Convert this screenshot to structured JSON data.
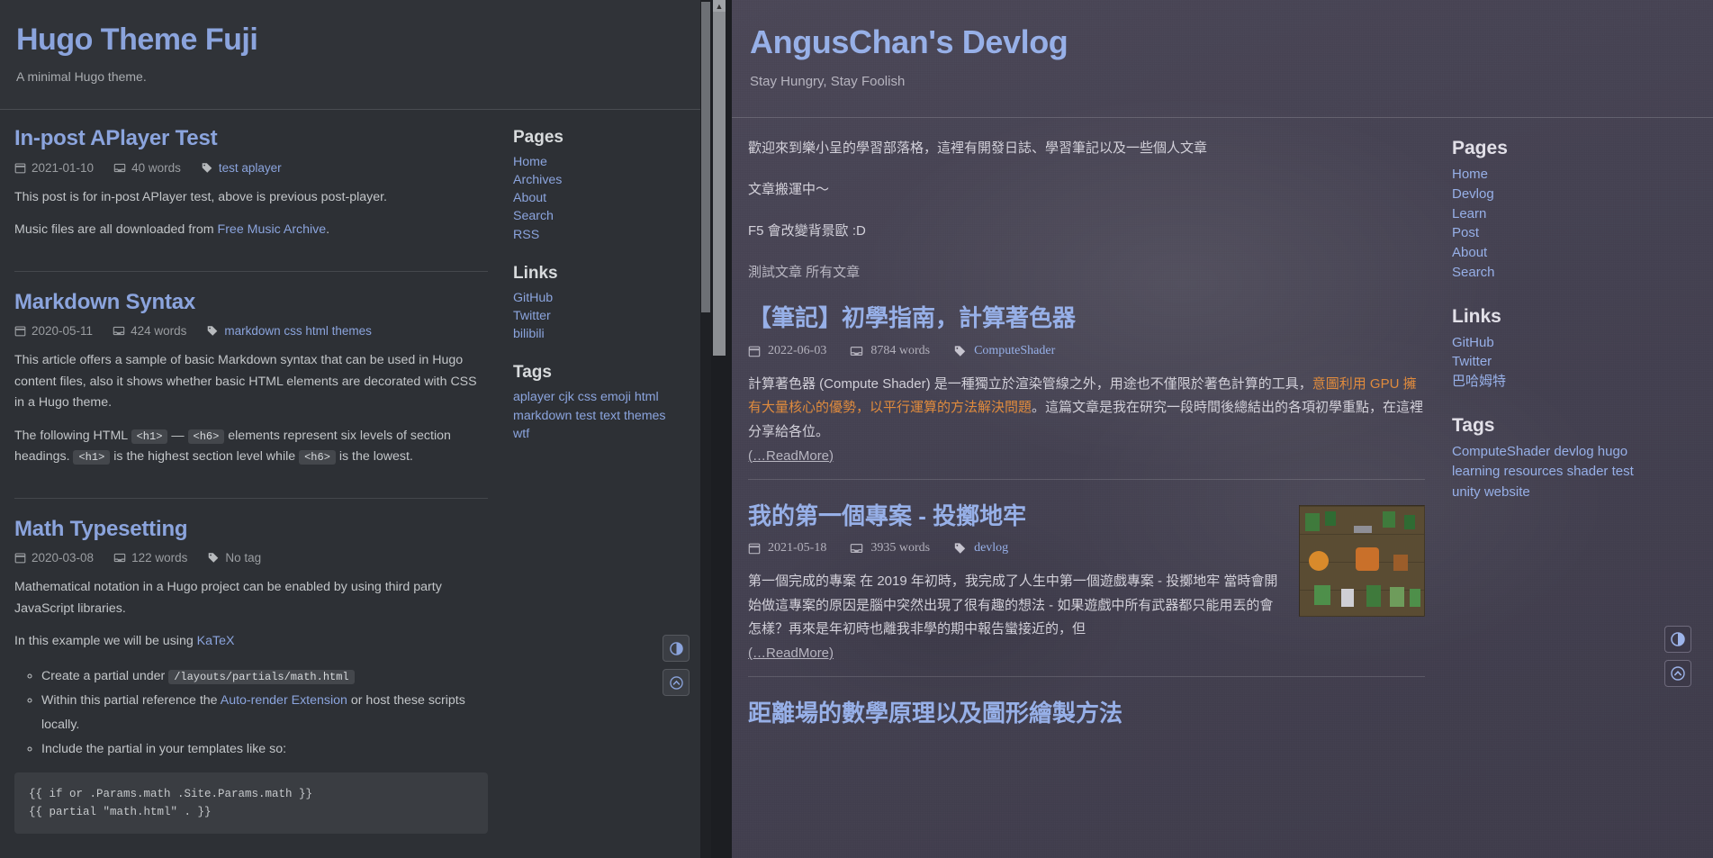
{
  "left_panel": {
    "header": {
      "site_title": "Hugo Theme Fuji",
      "subtitle": "A minimal Hugo theme."
    },
    "posts": [
      {
        "title": "In-post APlayer Test",
        "date": "2021-01-10",
        "words": "40 words",
        "tags": "test aplayer",
        "paragraphs": [
          "This post is for in-post APlayer test, above is previous post-player.",
          "Music files are all downloaded from Free Music Archive."
        ],
        "link_text": "Free Music Archive"
      },
      {
        "title": "Markdown Syntax",
        "date": "2020-05-11",
        "words": "424 words",
        "tags": "markdown css html themes",
        "paragraphs": [
          "This article offers a sample of basic Markdown syntax that can be used in Hugo content files, also it shows whether basic HTML elements are decorated with CSS in a Hugo theme."
        ],
        "html_sentence_1": "The following HTML",
        "code_h1": "<h1>",
        "dash": "—",
        "code_h6": "<h6>",
        "html_sentence_2": "elements represent six levels of section headings.",
        "html_sentence_3": "is the highest section level while",
        "code_h6b": "<h6>",
        "html_sentence_4": "is the lowest."
      },
      {
        "title": "Math Typesetting",
        "date": "2020-03-08",
        "words": "122 words",
        "tags": "No tag",
        "paragraphs": [
          "Mathematical notation in a Hugo project can be enabled by using third party JavaScript libraries.",
          "In this example we will be using KaTeX"
        ],
        "katex_link": "KaTeX",
        "bullets": [
          {
            "pre": "Create a partial under",
            "code": "/layouts/partials/math.html",
            "post": ""
          },
          {
            "pre": "Within this partial reference the",
            "link": "Auto-render Extension",
            "post": "or host these scripts locally."
          },
          {
            "pre": "Include the partial in your templates like so:",
            "code": "",
            "post": ""
          }
        ],
        "codeblock": "{{ if or .Params.math .Site.Params.math }}\n{{ partial \"math.html\" . }}"
      }
    ],
    "sidebar": {
      "pages_heading": "Pages",
      "pages": [
        "Home",
        "Archives",
        "About",
        "Search",
        "RSS"
      ],
      "links_heading": "Links",
      "links": [
        "GitHub",
        "Twitter",
        "bilibili"
      ],
      "tags_heading": "Tags",
      "tags": "aplayer cjk css emoji html markdown test text themes wtf"
    },
    "fab": {
      "theme_toggle": "theme-toggle",
      "back_to_top": "back-to-top"
    }
  },
  "right_panel": {
    "header": {
      "site_title": "AngusChan's Devlog",
      "subtitle": "Stay Hungry, Stay Foolish"
    },
    "intro": [
      "歡迎來到樂小呈的學習部落格，這裡有開發日誌、學習筆記以及一些個人文章",
      "文章搬運中～",
      "F5 會改變背景歐 :D",
      "測試文章 所有文章"
    ],
    "posts": [
      {
        "title": "【筆記】初學指南，計算著色器",
        "date": "2022-06-03",
        "words": "8784 words",
        "tags": "ComputeShader",
        "excerpt_part1": "計算著色器 (Compute Shader) 是一種獨立於渲染管線之外，用途也不僅限於著色計算的工具，",
        "excerpt_highlight": "意圖利用 GPU 擁有大量核心的優勢，以平行運算的方法解決問題",
        "excerpt_part2": "。這篇文章是我在研究一段時間後總結出的各項初學重點，在這裡分享給各位。",
        "readmore": "(…ReadMore)"
      },
      {
        "title": "我的第一個專案 - 投擲地牢",
        "date": "2021-05-18",
        "words": "3935 words",
        "tags": "devlog",
        "excerpt_part1": "第一個完成的專案 在 2019 年初時，我完成了人生中第一個遊戲專案 - 投擲地牢 當時會開始做這專案的原因是腦中突然出現了很有趣的想法 - 如果遊戲中所有武器都只能用丟的會怎樣？再來是年初時也離我非學的期中報告蠻接近的，但",
        "readmore": "(…ReadMore)",
        "thumbnail": "pixel-dungeon-screenshot"
      },
      {
        "title": "距離場的數學原理以及圖形繪製方法"
      }
    ],
    "sidebar": {
      "pages_heading": "Pages",
      "pages": [
        "Home",
        "Devlog",
        "Learn",
        "Post",
        "About",
        "Search"
      ],
      "links_heading": "Links",
      "links": [
        "GitHub",
        "Twitter",
        "巴哈姆特"
      ],
      "tags_heading": "Tags",
      "tags": "ComputeShader devlog hugo learning resources shader test unity website"
    },
    "fab": {
      "theme_toggle": "theme-toggle",
      "back_to_top": "back-to-top"
    }
  },
  "colors": {
    "left_bg": "#2d3035",
    "right_bg": "#45424f",
    "link_blue": "#8ba4dd",
    "highlight_orange": "#e08b3d"
  }
}
